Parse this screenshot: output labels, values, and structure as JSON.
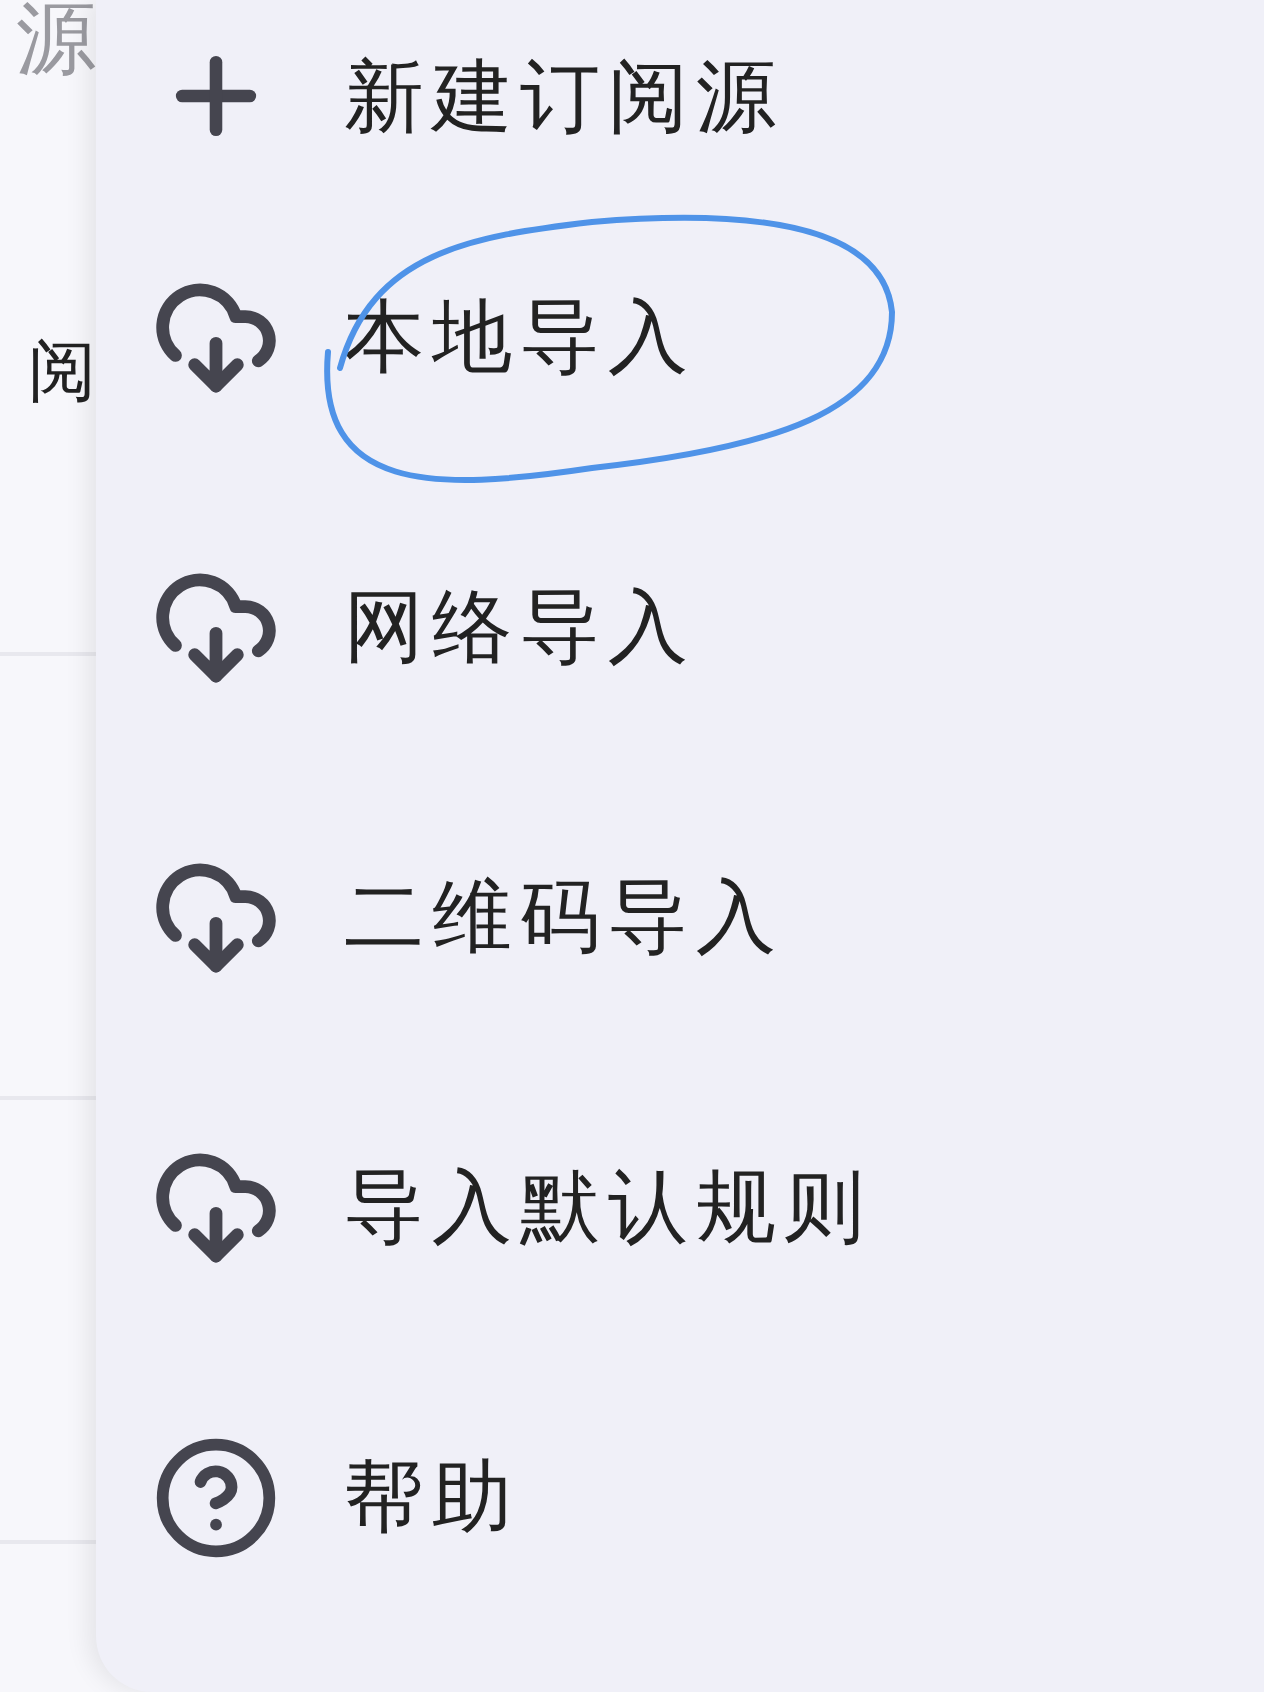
{
  "background_page": {
    "title_fragment": "源",
    "row_fragment": "阅"
  },
  "menu": {
    "items": [
      {
        "kind": "add",
        "label": "新建订阅源",
        "highlighted": false
      },
      {
        "kind": "import",
        "label": "本地导入",
        "highlighted": true
      },
      {
        "kind": "import",
        "label": "网络导入",
        "highlighted": false
      },
      {
        "kind": "import",
        "label": "二维码导入",
        "highlighted": false
      },
      {
        "kind": "import",
        "label": "导入默认规则",
        "highlighted": false
      },
      {
        "kind": "help",
        "label": "帮助",
        "highlighted": false
      }
    ]
  }
}
